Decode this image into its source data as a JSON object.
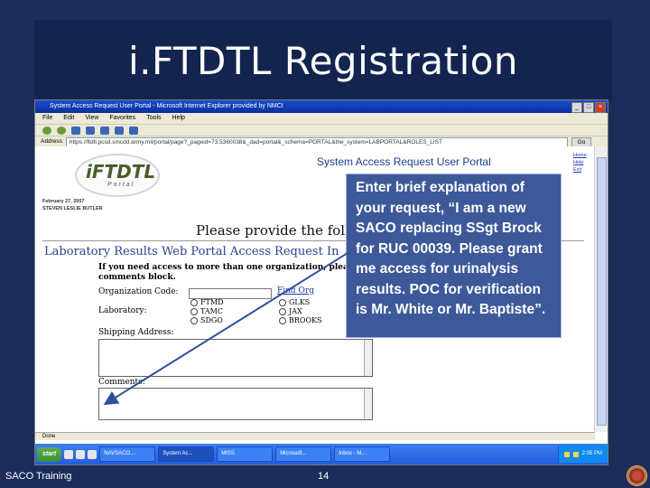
{
  "slide": {
    "title": "i.FTDTL Registration",
    "footer_left": "SACO Training",
    "page_number": "14"
  },
  "browser": {
    "window_title": "System Access Request User Portal - Microsoft Internet Explorer provided by NMCI",
    "menu": [
      "File",
      "Edit",
      "View",
      "Favorites",
      "Tools",
      "Help"
    ],
    "address_label": "Address",
    "address_url": "https://ftdtl.pcsd.smcdd.army.mil/portal/page?_pageid=73,5360038&_dad=portal&_schema=PORTAL&the_system=LABPORTAL&ROLES_LIST",
    "go_label": "Go",
    "status": "Done"
  },
  "page": {
    "logo_text": "iFTDTL",
    "logo_sub": "Portal",
    "portal_title": "System Access Request User Portal",
    "user_links": [
      "Home",
      "Help",
      "Exit"
    ],
    "date": "February 27, 2007",
    "user_name": "STEVEN LESLIE BUTLER",
    "provide_text": "Please provide the follow",
    "section_title": "Laboratory Results Web Portal Access Request In",
    "instruction_line1": "If you need access to more than one organization, pleas",
    "instruction_line2": "comments block.",
    "org_code_label": "Organization Code:",
    "find_org_label": "Find Org",
    "laboratory_label": "Laboratory:",
    "labs": [
      {
        "label": "FTMD"
      },
      {
        "label": "GLKS"
      },
      {
        "label": "TAMC"
      },
      {
        "label": "JAX"
      },
      {
        "label": "SDGO"
      },
      {
        "label": "BROOKS"
      }
    ],
    "shipping_label": "Shipping Address:",
    "comments_label": "Comments:"
  },
  "taskbar": {
    "start": "start",
    "tasks": [
      "",
      "",
      "NAVSACO...",
      "System Ac...",
      "MISS",
      "Microsoft...",
      "Inbox - M..."
    ],
    "clock": "2:05 PM"
  },
  "callout": {
    "text": "Enter brief explanation of your request, “I am a new SACO replacing SSgt Brock for RUC 00039. Please grant me access for urinalysis results. POC for verification is Mr. White or Mr. Baptiste”."
  }
}
